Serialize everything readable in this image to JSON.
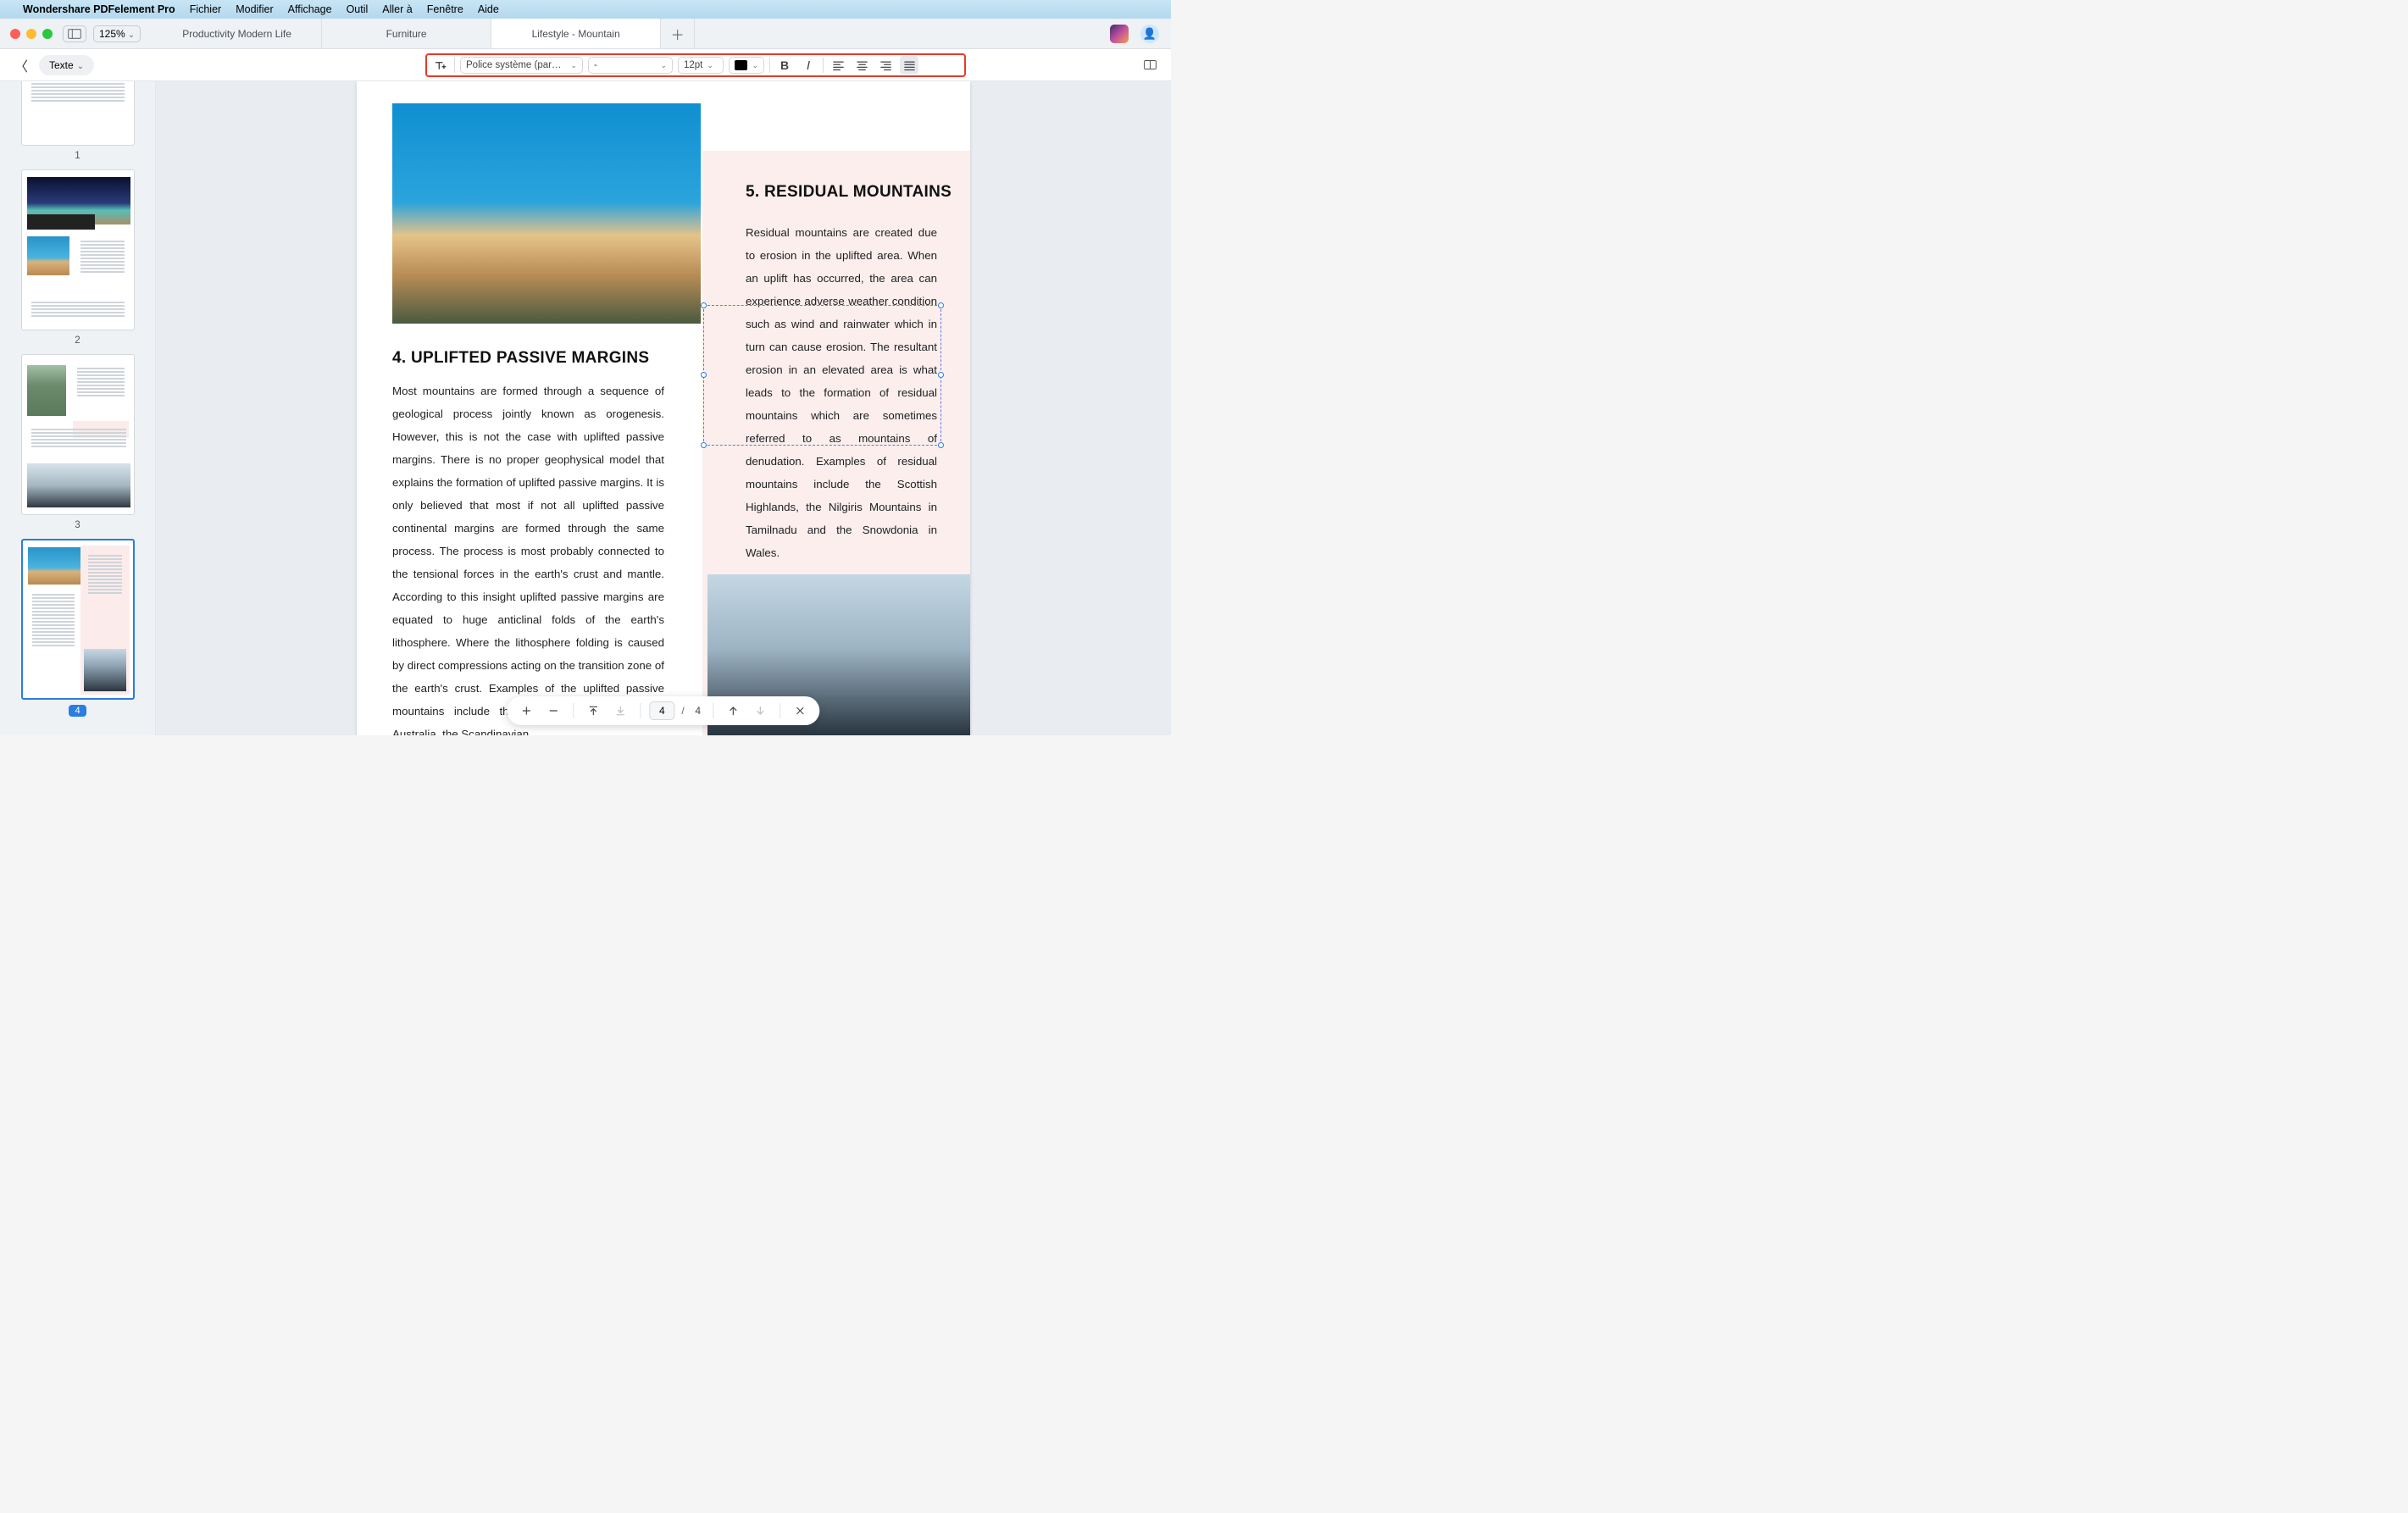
{
  "menubar": {
    "app": "Wondershare PDFelement Pro",
    "items": [
      "Fichier",
      "Modifier",
      "Affichage",
      "Outil",
      "Aller à",
      "Fenêtre",
      "Aide"
    ]
  },
  "titlebar": {
    "zoom": "125%",
    "tabs": [
      {
        "label": "Productivity Modern Life",
        "active": false
      },
      {
        "label": "Furniture",
        "active": false
      },
      {
        "label": "Lifestyle - Mountain",
        "active": true
      }
    ],
    "new_tab_glyph": "＋"
  },
  "toolbar": {
    "back_glyph": "〈",
    "mode_label": "Texte",
    "font": "Police système (par…",
    "style": "-",
    "size": "12pt",
    "color": "#000000",
    "bold_glyph": "B",
    "italic_glyph": "I"
  },
  "thumbs": {
    "count": 4,
    "labels": [
      "1",
      "2",
      "3",
      "4"
    ],
    "selected_index": 3
  },
  "document": {
    "left_heading": "4. UPLIFTED PASSIVE MARGINS",
    "left_body": "Most mountains are formed through a sequence of geological process jointly known as orogenesis. However, this is not the case with uplifted passive margins. There is no proper geophysical model that explains the formation of uplifted passive margins. It is only believed that most if not all uplifted passive continental margins are formed through the same process. The process is most probably connected to the tensional forces in the earth's crust and mantle. According to this insight uplifted passive margins are equated to huge anticlinal folds of the earth's lithosphere. Where the lithosphere folding is caused by direct compressions acting on the transition zone of the earth's crust. Examples of the uplifted passive mountains include the Great Dividing Range in Australia, the Scandinavian",
    "right_heading": "5. RESIDUAL MOUNTAINS",
    "right_body": "Residual mountains are created due to erosion in the uplifted area. When an uplift has occurred, the area can experience adverse weather condition such as wind and rainwater which in turn can cause erosion. The resultant erosion in an elevated area is what leads to the formation of residual mountains which are sometimes referred to as mountains of denudation. Examples of residual mountains include the Scottish Highlands, the Nilgiris Mountains in Tamilnadu and the Snowdonia in Wales."
  },
  "pagenav": {
    "current": "4",
    "sep": "/",
    "total": "4"
  },
  "icons": {
    "apple": "",
    "user": "👤"
  }
}
